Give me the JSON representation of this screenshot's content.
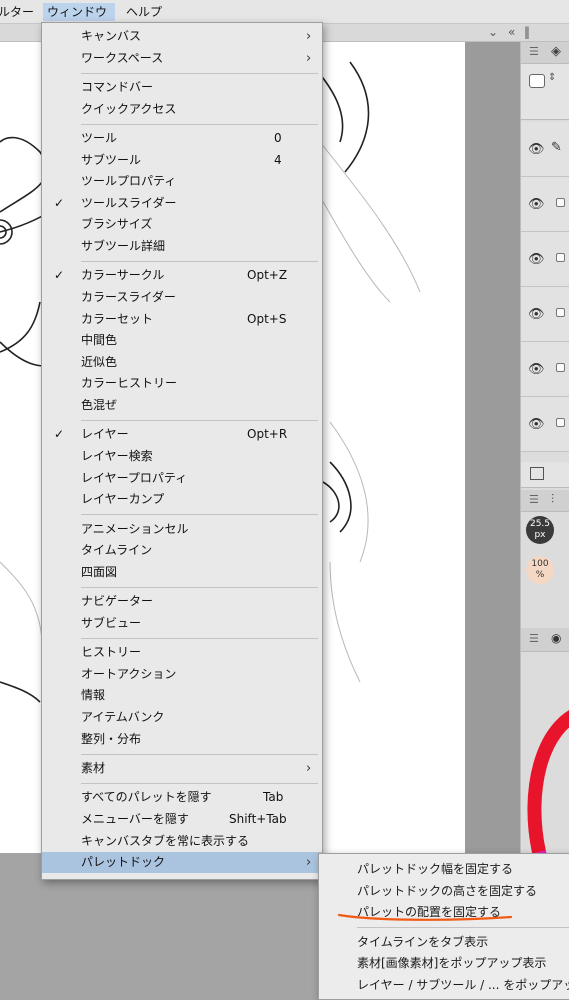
{
  "menubar": {
    "filter_label": "ルター",
    "window_label": "ウィンドウ",
    "help_label": "ヘルプ"
  },
  "window_menu": {
    "groups": [
      [
        {
          "label": "キャンバス",
          "submenu": true
        },
        {
          "label": "ワークスペース",
          "submenu": true
        }
      ],
      [
        {
          "label": "コマンドバー"
        },
        {
          "label": "クイックアクセス"
        }
      ],
      [
        {
          "label": "ツール",
          "shortcut": "0"
        },
        {
          "label": "サブツール",
          "shortcut": "4"
        },
        {
          "label": "ツールプロパティ"
        },
        {
          "label": "ツールスライダー",
          "checked": true
        },
        {
          "label": "ブラシサイズ"
        },
        {
          "label": "サブツール詳細"
        }
      ],
      [
        {
          "label": "カラーサークル",
          "shortcut": "Opt+Z",
          "checked": true
        },
        {
          "label": "カラースライダー"
        },
        {
          "label": "カラーセット",
          "shortcut": "Opt+S"
        },
        {
          "label": "中間色"
        },
        {
          "label": "近似色"
        },
        {
          "label": "カラーヒストリー"
        },
        {
          "label": "色混ぜ"
        }
      ],
      [
        {
          "label": "レイヤー",
          "shortcut": "Opt+R",
          "checked": true
        },
        {
          "label": "レイヤー検索"
        },
        {
          "label": "レイヤープロパティ"
        },
        {
          "label": "レイヤーカンプ"
        }
      ],
      [
        {
          "label": "アニメーションセル"
        },
        {
          "label": "タイムライン"
        },
        {
          "label": "四面図"
        }
      ],
      [
        {
          "label": "ナビゲーター"
        },
        {
          "label": "サブビュー"
        }
      ],
      [
        {
          "label": "ヒストリー"
        },
        {
          "label": "オートアクション"
        },
        {
          "label": "情報"
        },
        {
          "label": "アイテムバンク"
        },
        {
          "label": "整列・分布"
        }
      ],
      [
        {
          "label": "素材",
          "submenu": true
        }
      ],
      [
        {
          "label": "すべてのパレットを隠す",
          "shortcut": "Tab"
        },
        {
          "label": "メニューバーを隠す",
          "shortcut": "Shift+Tab"
        },
        {
          "label": "キャンバスタブを常に表示する"
        },
        {
          "label": "パレットドック",
          "submenu": true,
          "highlighted": true
        }
      ]
    ]
  },
  "palette_dock_submenu": {
    "groups": [
      [
        "パレットドック幅を固定する",
        "パレットドックの高さを固定する",
        "パレットの配置を固定する"
      ],
      [
        "タイムラインをタブ表示",
        "素材[画像素材]をポップアップ表示",
        "レイヤー / サブツール / ... をポップアップ"
      ]
    ]
  },
  "right_panel": {
    "brush_size": "25.5\npx",
    "opacity": "100\n%"
  },
  "colors": {
    "menu_bg": "#e9e9e9",
    "highlight": "#aac4e0",
    "annotation": "#f05a14"
  }
}
